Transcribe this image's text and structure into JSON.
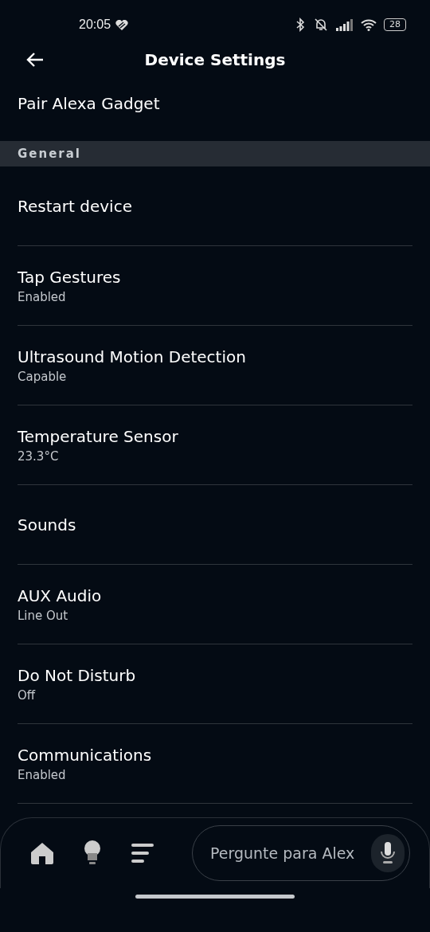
{
  "status_bar": {
    "time": "20:05",
    "battery": "28"
  },
  "header": {
    "title": "Device Settings"
  },
  "top_item": {
    "label": "Pair Alexa Gadget"
  },
  "section": {
    "title": "General"
  },
  "items": [
    {
      "label": "Restart device"
    },
    {
      "label": "Tap Gestures",
      "value": "Enabled"
    },
    {
      "label": "Ultrasound Motion Detection",
      "value": "Capable"
    },
    {
      "label": "Temperature Sensor",
      "value": "23.3°C"
    },
    {
      "label": "Sounds"
    },
    {
      "label": "AUX Audio",
      "value": "Line Out"
    },
    {
      "label": "Do Not Disturb",
      "value": "Off"
    },
    {
      "label": "Communications",
      "value": "Enabled"
    }
  ],
  "bottom_nav": {
    "items": [
      {
        "kind": "home"
      },
      {
        "kind": "bulb"
      },
      {
        "kind": "list"
      }
    ],
    "search": {
      "placeholder": "Pergunte para Alex"
    }
  }
}
